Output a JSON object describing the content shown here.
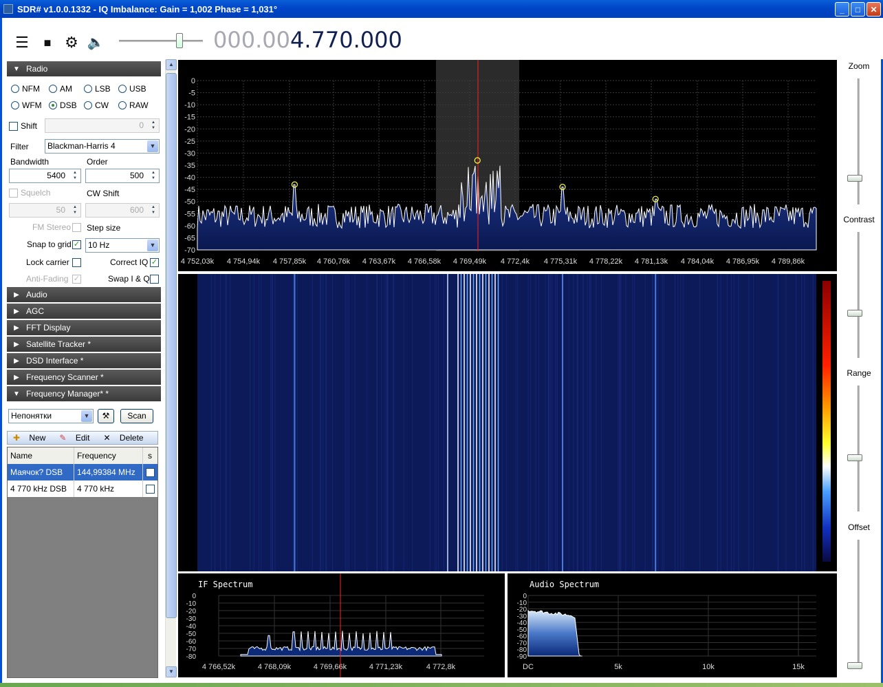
{
  "window": {
    "title": "SDR# v1.0.0.1332 - IQ Imbalance: Gain = 1,002 Phase = 1,031°",
    "buttons": [
      "_",
      "□",
      "✕"
    ]
  },
  "toolbar": {
    "icons": [
      "menu-icon",
      "stop-icon",
      "gear-icon",
      "speaker-icon"
    ],
    "frequency_dim": "000.00",
    "frequency_bright": "4.770.000"
  },
  "radio": {
    "header": "Radio",
    "modes": [
      "NFM",
      "AM",
      "LSB",
      "USB",
      "WFM",
      "DSB",
      "CW",
      "RAW"
    ],
    "selected_mode": "DSB",
    "shift_label": "Shift",
    "shift_value": "0",
    "filter_label": "Filter",
    "filter_value": "Blackman-Harris 4",
    "bandwidth_label": "Bandwidth",
    "bandwidth_value": "5400",
    "order_label": "Order",
    "order_value": "500",
    "squelch_label": "Squelch",
    "squelch_value": "50",
    "cwshift_label": "CW Shift",
    "cwshift_value": "600",
    "fmstereo_label": "FM Stereo",
    "stepsize_label": "Step size",
    "snap_label": "Snap to grid",
    "snap_value": "10 Hz",
    "lockcarrier_label": "Lock carrier",
    "correctiq_label": "Correct IQ",
    "antifading_label": "Anti-Fading",
    "swapiq_label": "Swap I & Q"
  },
  "sections": [
    {
      "label": "Audio",
      "arrow": "▶"
    },
    {
      "label": "AGC",
      "arrow": "▶"
    },
    {
      "label": "FFT Display",
      "arrow": "▶"
    },
    {
      "label": "Satellite Tracker *",
      "arrow": "▶"
    },
    {
      "label": "DSD Interface *",
      "arrow": "▶"
    },
    {
      "label": "Frequency Scanner *",
      "arrow": "▶"
    },
    {
      "label": "Frequency Manager* *",
      "arrow": "▼"
    }
  ],
  "freqmanager": {
    "group": "Непонятки",
    "scan_label": "Scan",
    "new_label": "New",
    "edit_label": "Edit",
    "delete_label": "Delete",
    "columns": [
      "Name",
      "Frequency",
      "s"
    ],
    "rows": [
      {
        "name": "Маячок? DSB",
        "freq": "144,99384 MHz"
      },
      {
        "name": "4 770 kHz DSB",
        "freq": "4 770 kHz"
      }
    ]
  },
  "rightpanel": {
    "zoom": "Zoom",
    "contrast": "Contrast",
    "range": "Range",
    "offset": "Offset"
  },
  "colors": {
    "plot_bg": "#000000",
    "spectrum_fill": "#0a1850",
    "waterfall_bg": "#0c1a5a",
    "center_line": "#ff2020",
    "trace": "#ffffff"
  },
  "chart_data": [
    {
      "type": "line",
      "title": "",
      "ylabel": "dB",
      "ylim": [
        -70,
        0
      ],
      "yticks": [
        "0",
        "-5",
        "-10",
        "-15",
        "-20",
        "-25",
        "-30",
        "-35",
        "-40",
        "-45",
        "-50",
        "-55",
        "-60",
        "-65",
        "-70"
      ],
      "xticks": [
        "4 752,03k",
        "4 754,94k",
        "4 757,85k",
        "4 760,76k",
        "4 763,67k",
        "4 766,58k",
        "4 769,49k",
        "4 772,4k",
        "4 775,31k",
        "4 778,22k",
        "4 781,13k",
        "4 784,04k",
        "4 786,95k",
        "4 789,86k"
      ],
      "peaks": [
        {
          "freq_khz": 4758.2,
          "level_db": -43
        },
        {
          "freq_khz": 4769.8,
          "level_db": -33
        },
        {
          "freq_khz": 4775.2,
          "level_db": -44
        },
        {
          "freq_khz": 4781.1,
          "level_db": -49
        }
      ],
      "noise_floor_db": -56,
      "center_khz": 4770
    },
    {
      "type": "line",
      "title": "IF Spectrum",
      "ylim": [
        -80,
        0
      ],
      "yticks": [
        "0",
        "-10",
        "-20",
        "-30",
        "-40",
        "-50",
        "-60",
        "-70",
        "-80"
      ],
      "xticks": [
        "4 766,52k",
        "4 768,09k",
        "4 769,66k",
        "4 771,23k",
        "4 772,8k"
      ],
      "noise_floor_db": -70,
      "center_khz": 4769.9
    },
    {
      "type": "area",
      "title": "Audio Spectrum",
      "ylim": [
        -90,
        0
      ],
      "yticks": [
        "0",
        "-10",
        "-20",
        "-30",
        "-40",
        "-50",
        "-60",
        "-70",
        "-80",
        "-90"
      ],
      "xticks": [
        "DC",
        "5k",
        "10k",
        "15k"
      ],
      "cutoff_hz": 2700
    }
  ]
}
